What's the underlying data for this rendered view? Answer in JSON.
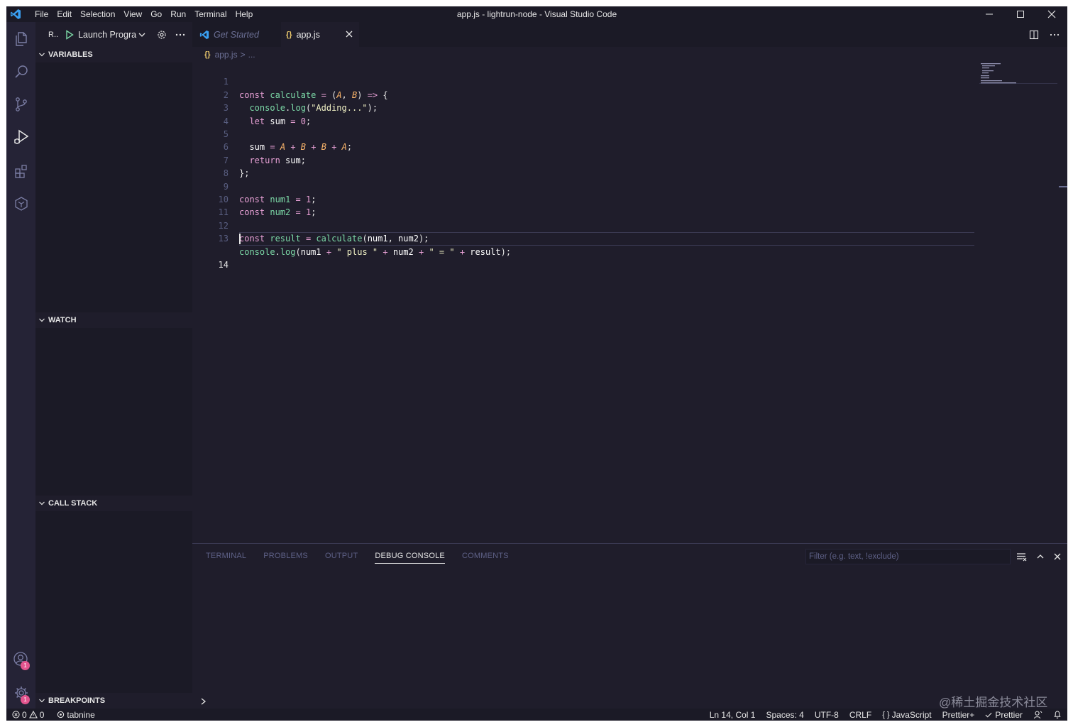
{
  "title_bar": {
    "menu": [
      "File",
      "Edit",
      "Selection",
      "View",
      "Go",
      "Run",
      "Terminal",
      "Help"
    ],
    "window_title": "app.js - lightrun-node - Visual Studio Code"
  },
  "debug": {
    "view_title": "R..",
    "launch_config": "Launch Progra"
  },
  "sidebar": {
    "sections": {
      "variables": "VARIABLES",
      "watch": "WATCH",
      "call_stack": "CALL STACK",
      "breakpoints": "BREAKPOINTS"
    }
  },
  "activity_badges": {
    "accounts": "1",
    "manage": "1"
  },
  "editor": {
    "tabs": [
      {
        "label": "Get Started",
        "active": false
      },
      {
        "label": "app.js",
        "active": true
      }
    ],
    "breadcrumb": {
      "file": "app.js",
      "sep": ">",
      "more": "..."
    },
    "line_numbers": [
      "1",
      "2",
      "3",
      "4",
      "5",
      "6",
      "7",
      "8",
      "9",
      "10",
      "11",
      "12",
      "13",
      "14"
    ],
    "active_line": 14,
    "code_lines": [
      "const calculate = (A, B) => {",
      "  console.log(\"Adding...\");",
      "  let sum = 0;",
      "",
      "  sum = A + B + B + A;",
      "  return sum;",
      "};",
      "",
      "const num1 = 1;",
      "const num2 = 1;",
      "",
      "const result = calculate(num1, num2);",
      "console.log(num1 + \" plus \" + num2 + \" = \" + result);",
      ""
    ]
  },
  "panel": {
    "tabs": [
      "TERMINAL",
      "PROBLEMS",
      "OUTPUT",
      "DEBUG CONSOLE",
      "COMMENTS"
    ],
    "active_tab": "DEBUG CONSOLE",
    "filter_placeholder": "Filter (e.g. text, !exclude)"
  },
  "status_bar": {
    "errors": "0",
    "warnings": "0",
    "tabnine": "tabnine",
    "position": "Ln 14, Col 1",
    "spaces": "Spaces: 4",
    "encoding": "UTF-8",
    "eol": "CRLF",
    "language": "JavaScript",
    "prettier_plus": "Prettier+",
    "prettier": "Prettier"
  },
  "watermark": "@稀土掘金技术社区",
  "colors": {
    "background": "#1f1d2b",
    "sidebar_body": "#1b1a26",
    "keyword": "#e7a0d5",
    "function": "#7cd9a7",
    "parameter": "#ffb86c",
    "string": "#f1f2c5",
    "badge": "#e2548e",
    "vscode_blue": "#3aa0f2"
  }
}
